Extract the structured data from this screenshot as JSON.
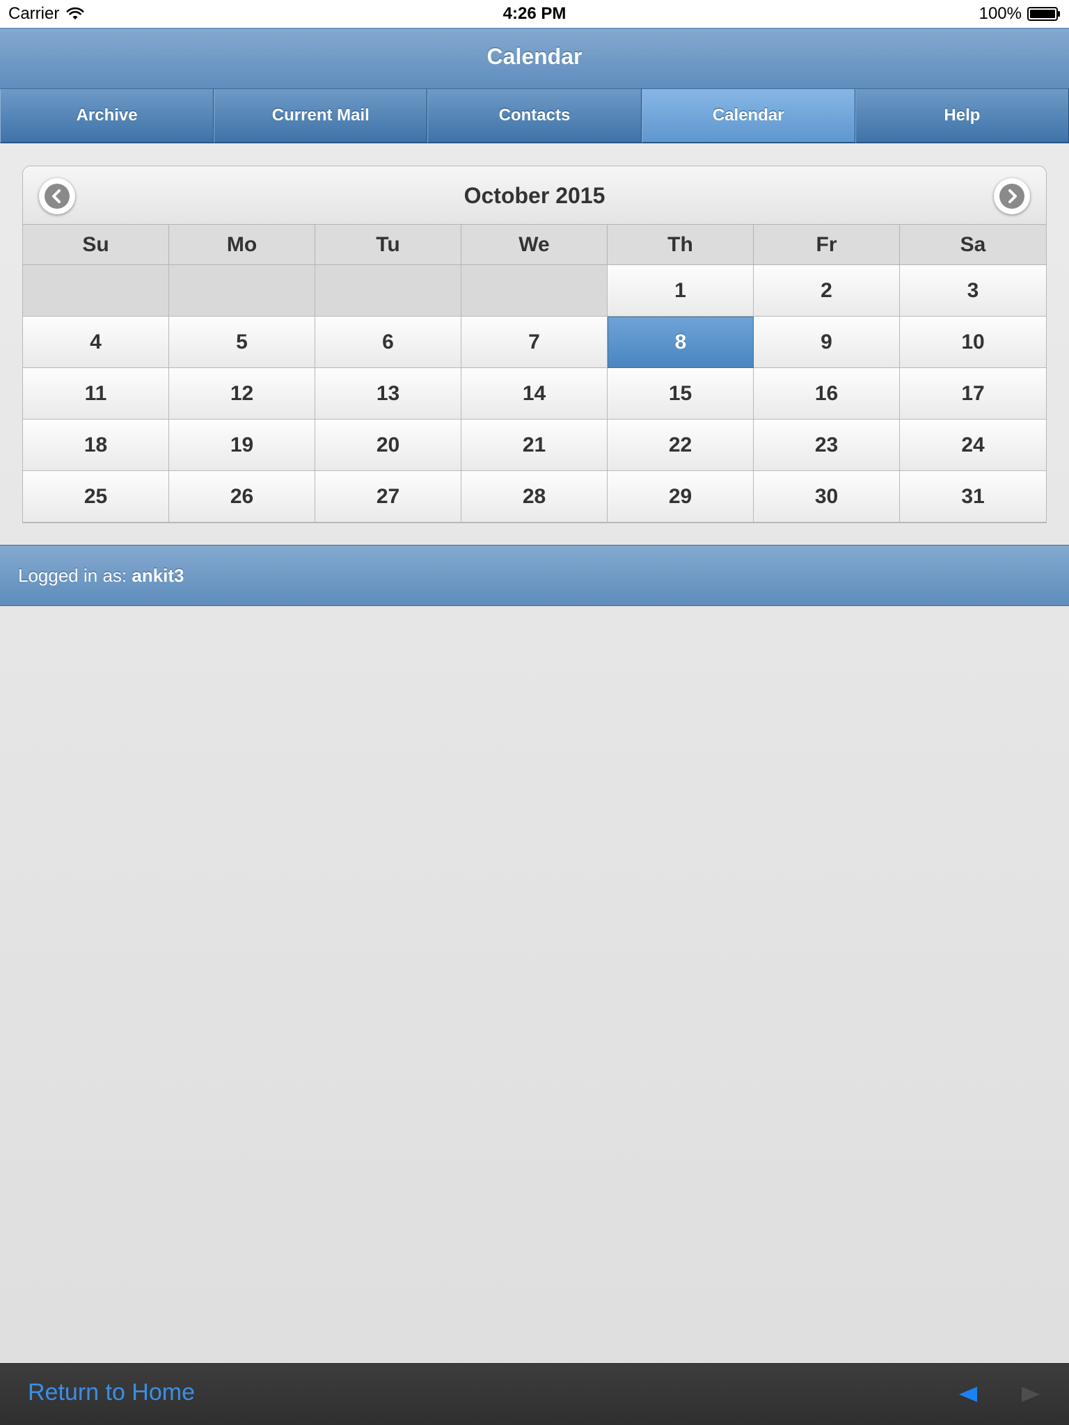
{
  "status_bar": {
    "carrier": "Carrier",
    "time": "4:26 PM",
    "battery": "100%"
  },
  "header": {
    "title": "Calendar"
  },
  "nav": {
    "tabs": [
      {
        "label": "Archive"
      },
      {
        "label": "Current Mail"
      },
      {
        "label": "Contacts"
      },
      {
        "label": "Calendar",
        "active": true
      },
      {
        "label": "Help"
      }
    ]
  },
  "calendar": {
    "month_label": "October 2015",
    "weekdays": [
      "Su",
      "Mo",
      "Tu",
      "We",
      "Th",
      "Fr",
      "Sa"
    ],
    "leading_blank_days": 4,
    "days": [
      "1",
      "2",
      "3",
      "4",
      "5",
      "6",
      "7",
      "8",
      "9",
      "10",
      "11",
      "12",
      "13",
      "14",
      "15",
      "16",
      "17",
      "18",
      "19",
      "20",
      "21",
      "22",
      "23",
      "24",
      "25",
      "26",
      "27",
      "28",
      "29",
      "30",
      "31"
    ],
    "selected_day": "8",
    "selected_color": "#5a91c9"
  },
  "login_bar": {
    "prefix": "Logged in as: ",
    "username": "ankit3"
  },
  "bottom_bar": {
    "home_link": "Return to Home"
  },
  "colors": {
    "header_blue": "#6f98c6",
    "link_blue": "#3b8fe6"
  }
}
